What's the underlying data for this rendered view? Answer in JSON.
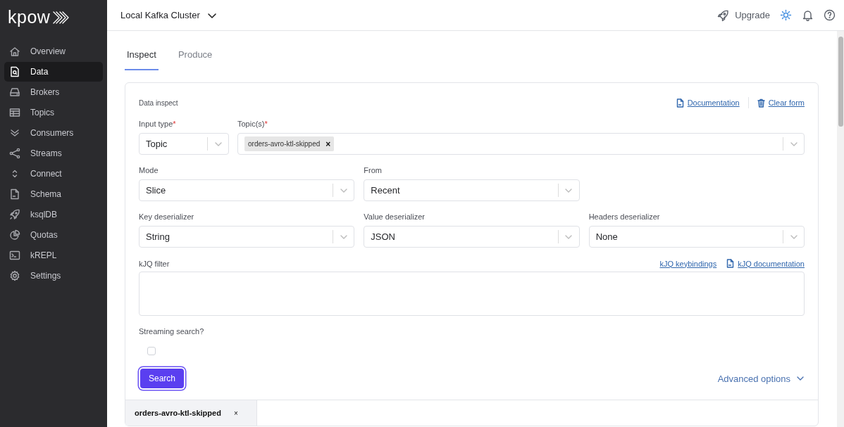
{
  "sidebar": {
    "logo": "kpow",
    "items": [
      {
        "label": "Overview",
        "selected": false
      },
      {
        "label": "Data",
        "selected": true
      },
      {
        "label": "Brokers",
        "selected": false
      },
      {
        "label": "Topics",
        "selected": false
      },
      {
        "label": "Consumers",
        "selected": false
      },
      {
        "label": "Streams",
        "selected": false
      },
      {
        "label": "Connect",
        "selected": false
      },
      {
        "label": "Schema",
        "selected": false
      },
      {
        "label": "ksqlDB",
        "selected": false
      },
      {
        "label": "Quotas",
        "selected": false
      },
      {
        "label": "kREPL",
        "selected": false
      },
      {
        "label": "Settings",
        "selected": false
      }
    ]
  },
  "topbar": {
    "cluster": "Local Kafka Cluster",
    "upgrade": "Upgrade"
  },
  "tabs": [
    {
      "label": "Inspect",
      "selected": true
    },
    {
      "label": "Produce",
      "selected": false
    }
  ],
  "form": {
    "title": "Data inspect",
    "links": [
      "Documentation",
      "Clear form"
    ],
    "input_type": {
      "label": "Input type",
      "required_mark": "*",
      "value": "Topic"
    },
    "topics": {
      "label": "Topic(s)",
      "required_mark": "*",
      "chips": [
        {
          "label": "orders-avro-ktl-skipped",
          "remove": "×"
        }
      ]
    },
    "mode": {
      "label": "Mode",
      "value": "Slice"
    },
    "from": {
      "label": "From",
      "value": "Recent"
    },
    "key_deserializer": {
      "label": "Key deserializer",
      "value": "String"
    },
    "value_deserializer": {
      "label": "Value deserializer",
      "value": "JSON"
    },
    "headers_deserializer": {
      "label": "Headers deserializer",
      "value": "None"
    },
    "kjq_filter": {
      "label": "kJQ filter",
      "links": [
        "kJQ keybindings",
        "kJQ documentation"
      ]
    },
    "streaming": {
      "label": "Streaming search?",
      "checked": false
    },
    "search_button": "Search",
    "advanced_options": "Advanced options"
  },
  "results": {
    "tabs": [
      {
        "label": "orders-avro-ktl-skipped",
        "close": "×",
        "selected": true
      }
    ]
  }
}
